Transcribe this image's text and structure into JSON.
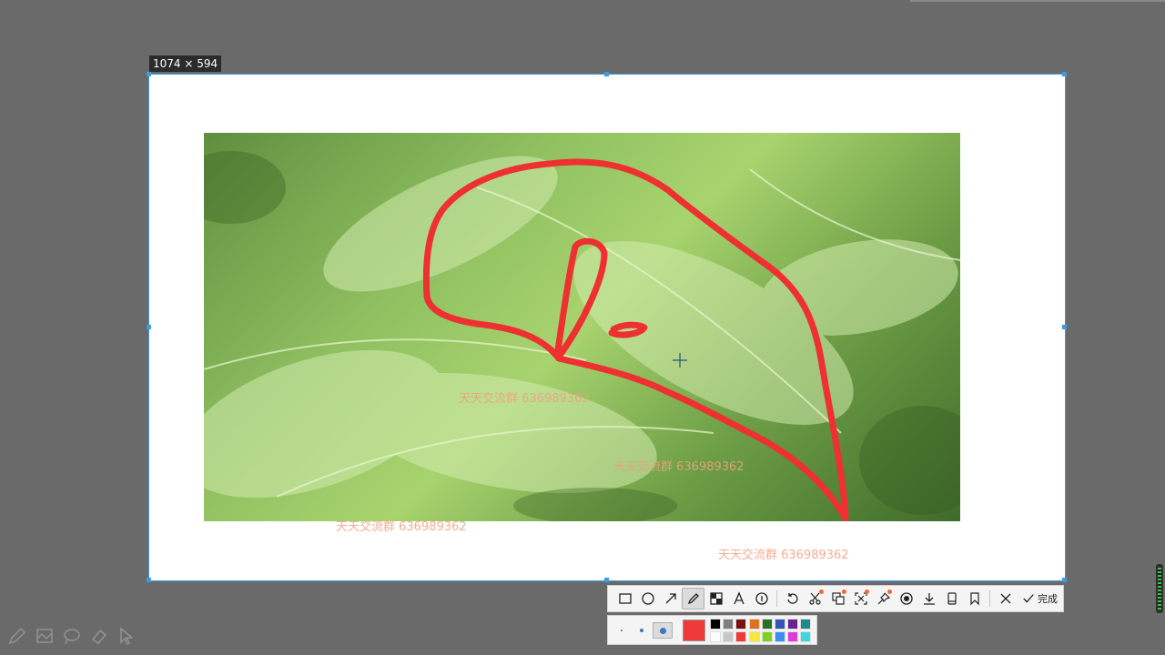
{
  "selection": {
    "size_label": "1074 × 594"
  },
  "watermarks": [
    "天天交流群  636989362",
    "天天交流群  636989362",
    "天天交流群  636989362",
    "天天交流群  636989362"
  ],
  "toolbar": {
    "tools": [
      {
        "name": "rectangle-tool",
        "icon": "rectangle-icon"
      },
      {
        "name": "ellipse-tool",
        "icon": "ellipse-icon"
      },
      {
        "name": "arrow-tool",
        "icon": "arrow-icon"
      },
      {
        "name": "pen-tool",
        "icon": "pen-icon",
        "active": true
      },
      {
        "name": "mosaic-tool",
        "icon": "mosaic-icon"
      },
      {
        "name": "text-tool",
        "icon": "text-icon"
      },
      {
        "name": "number-tool",
        "icon": "number-icon"
      },
      {
        "name": "undo-tool",
        "icon": "undo-icon"
      },
      {
        "name": "scissors-tool",
        "icon": "scissors-icon"
      },
      {
        "name": "copy-tool",
        "icon": "copy-icon"
      },
      {
        "name": "crop-tool",
        "icon": "crop-icon"
      },
      {
        "name": "pin-tool",
        "icon": "pin-icon"
      },
      {
        "name": "record-tool",
        "icon": "record-icon"
      },
      {
        "name": "save-tool",
        "icon": "download-icon"
      },
      {
        "name": "long-screenshot-tool",
        "icon": "phone-icon"
      },
      {
        "name": "bookmark-tool",
        "icon": "bookmark-icon"
      }
    ],
    "close_icon": "close-icon",
    "done_label": "完成"
  },
  "palette": {
    "current_color": "#f03a3a",
    "pen_sizes": [
      "small",
      "medium",
      "large"
    ],
    "selected_size": "large",
    "colors_row1": [
      "#000000",
      "#7f7f7f",
      "#7a1010",
      "#e0701f",
      "#2a6e2a",
      "#2f55b5",
      "#6a2490",
      "#1f8a8a"
    ],
    "colors_row2": [
      "#ffffff",
      "#c8c8c8",
      "#f03a3a",
      "#f7e83a",
      "#7ed321",
      "#3a8ef0",
      "#e03ad9",
      "#3ad9e0"
    ]
  },
  "colors": {
    "selection_border": "#3d9ce0",
    "annotation": "#ee3030",
    "backdrop": "#6a6a6a"
  }
}
